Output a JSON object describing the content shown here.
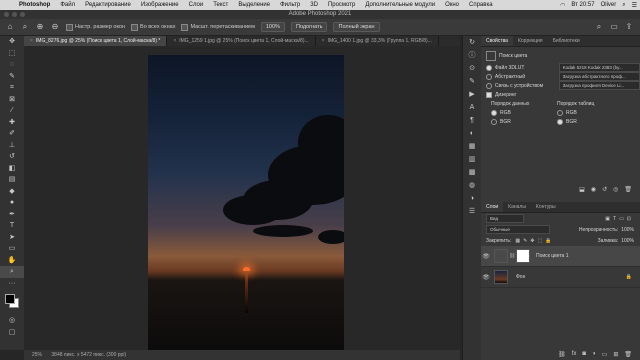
{
  "menubar": {
    "app": "Photoshop",
    "items": [
      "Файл",
      "Редактирование",
      "Изображение",
      "Слои",
      "Текст",
      "Выделение",
      "Фильтр",
      "3D",
      "Просмотр",
      "Дополнительные модули",
      "Окно",
      "Справка"
    ],
    "clock": "Вт 20:57",
    "user": "Oliver"
  },
  "window": {
    "title": "Adobe Photoshop 2021"
  },
  "options": {
    "fit_label": "Настр. размер окон",
    "all_windows_label": "Во всех окнах",
    "scrubby_label": "Масшт. перетаскиванием",
    "zoom_value": "100%",
    "fit_button": "Подогнать",
    "fill_button": "Полный экран"
  },
  "tabs": [
    "IMG_8276.jpg @ 25% (Поиск цвета 1, Слой-маска/8) *",
    "IMG_1259 1.jpg @ 25% (Поиск цвета 1, Слой-маска/8)...",
    "IMG_1400 1.jpg @ 33,3% (Группа 1, RGB/8)..."
  ],
  "status": {
    "zoom": "25%",
    "size": "3848 пикс. x 5472 пикс. (300 ppi)"
  },
  "properties": {
    "tabs": [
      "Свойства",
      "Коррекция",
      "Библиотеки"
    ],
    "title": "Поиск цвета",
    "rows": [
      {
        "label": "Файл 3DLUT",
        "value": "Kodak 5218 Kodak 2383 (by..."
      },
      {
        "label": "Абстрактный",
        "value": "Загрузка абстрактного проф..."
      },
      {
        "label": "Связь с устройством",
        "value": "Загрузка профиля Device Li..."
      }
    ],
    "dither": "Дизеринг",
    "data_order": "Порядок данных",
    "table_order": "Порядок таблиц",
    "rgb": "RGB",
    "bgr": "BGR"
  },
  "layers": {
    "tabs": [
      "Слои",
      "Каналы",
      "Контуры"
    ],
    "filter": "Вид",
    "blend_mode": "Обычные",
    "opacity_label": "Непрозрачность:",
    "opacity": "100%",
    "lock_label": "Закрепить:",
    "fill_label": "Заливка:",
    "fill": "100%",
    "items": [
      {
        "name": "Поиск цвета 1"
      },
      {
        "name": "Фон"
      }
    ]
  }
}
